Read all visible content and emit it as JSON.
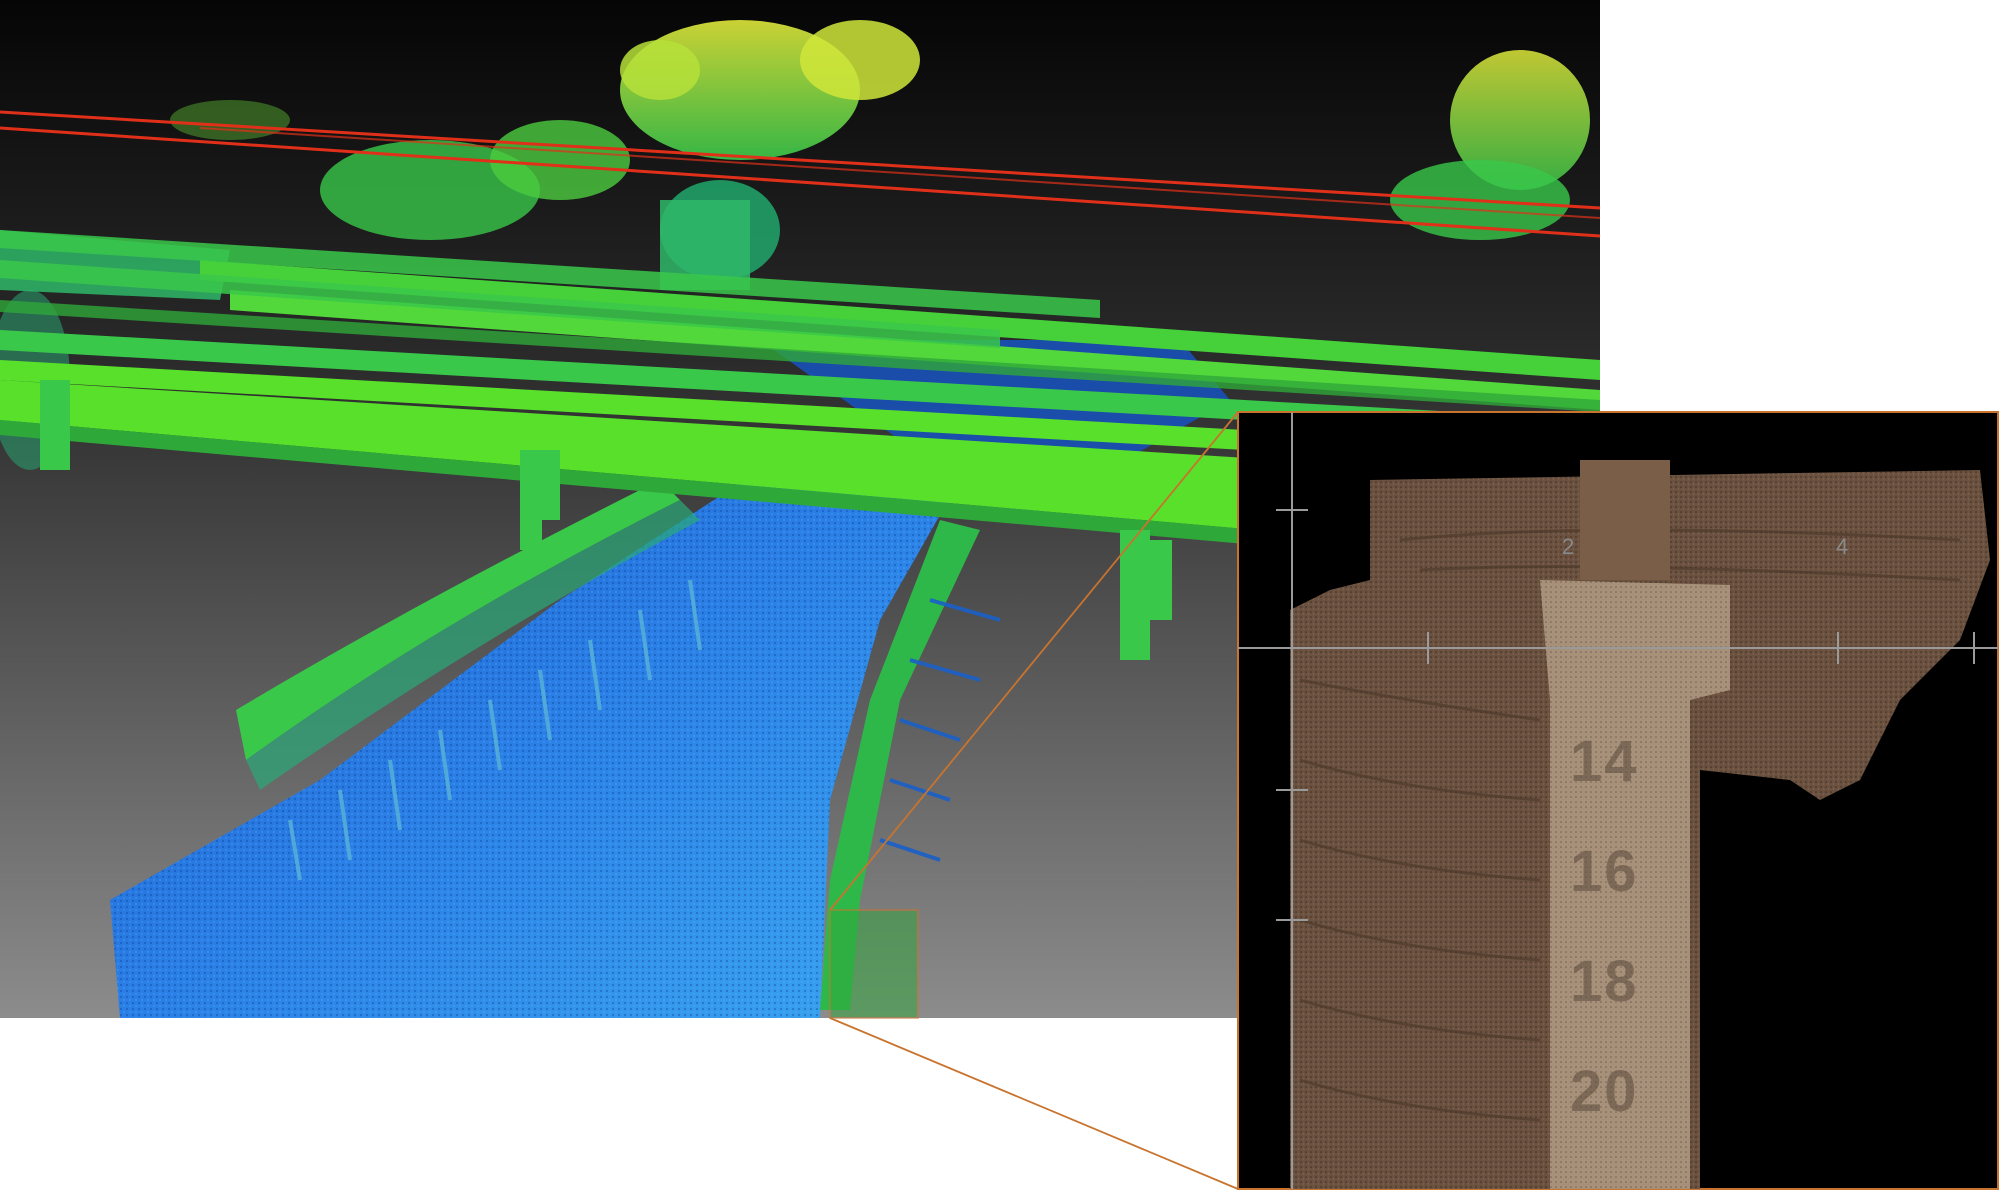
{
  "main_view": {
    "name": "point-cloud-height-colored",
    "colors": {
      "sky_top": "#0a0a0a",
      "ground_bottom": "#8a8a8a",
      "water": "#1a6fe0",
      "water_light": "#3aa0f0",
      "bridge": "#58e02a",
      "bridge_dark": "#2fa83a",
      "tree_high": "#d8e83a",
      "tree_mid": "#5acc3a",
      "powerline": "#e0301a"
    }
  },
  "zoom_box": {
    "color": "#c8742e"
  },
  "inset_view": {
    "name": "gauge-closeup-rgb",
    "axis_labels": [
      "2",
      "4"
    ],
    "gauge_numbers": [
      "14",
      "16",
      "18",
      "20"
    ],
    "colors": {
      "background": "#000000",
      "pier": "#6b5240",
      "gauge_face": "#a8917a",
      "axis": "#9a9a9a"
    }
  }
}
